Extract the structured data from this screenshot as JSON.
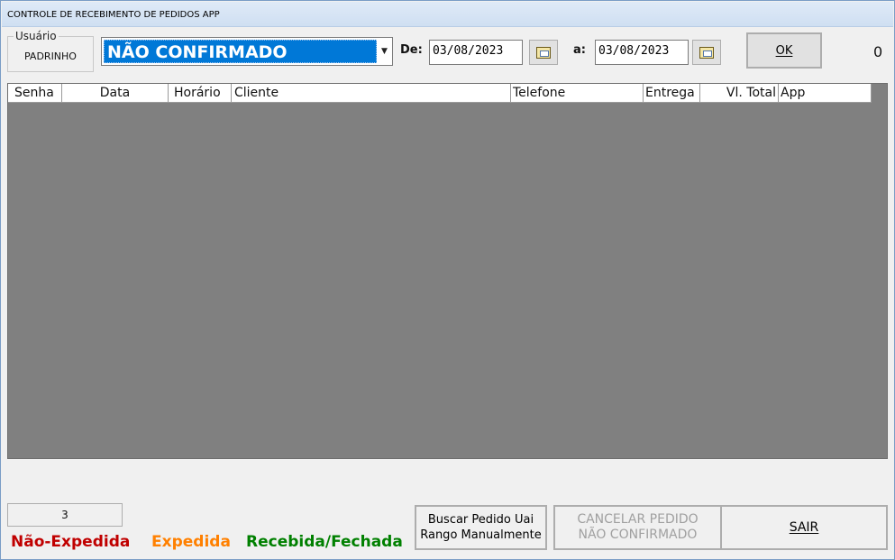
{
  "window": {
    "title": "CONTROLE DE RECEBIMENTO DE PEDIDOS APP"
  },
  "usuario": {
    "legend": "Usuário",
    "name": "PADRINHO"
  },
  "status_select": {
    "value": "NÃO CONFIRMADO"
  },
  "date_range": {
    "from_label": "De:",
    "from_value": "03/08/2023",
    "to_label": "a:",
    "to_value": "03/08/2023"
  },
  "ok_button": {
    "label": "OK"
  },
  "top_count": "0",
  "grid": {
    "columns": [
      {
        "label": "Senha"
      },
      {
        "label": "Data"
      },
      {
        "label": "Horário"
      },
      {
        "label": "Cliente"
      },
      {
        "label": "Telefone"
      },
      {
        "label": "Entrega"
      },
      {
        "label": "Vl. Total"
      },
      {
        "label": "App"
      }
    ],
    "rows": []
  },
  "record_count": "3",
  "legend": {
    "nao_expedida": {
      "label": "Não-Expedida",
      "color": "#c00000"
    },
    "expedida": {
      "label": "Expedida",
      "color": "#ff8000"
    },
    "recebida": {
      "label": "Recebida/Fechada",
      "color": "#008000"
    }
  },
  "buttons": {
    "buscar": {
      "line1": "Buscar Pedido Uai",
      "line2": "Rango Manualmente"
    },
    "cancelar": {
      "line1": "CANCELAR PEDIDO",
      "line2": "NÃO CONFIRMADO"
    },
    "sair": {
      "label": "SAIR"
    }
  }
}
